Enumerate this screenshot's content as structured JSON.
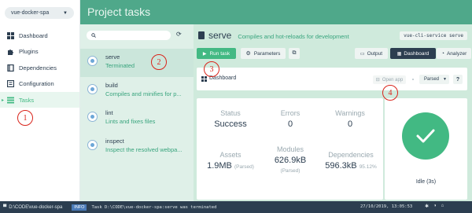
{
  "project": {
    "name": "vue-docker-spa"
  },
  "sidebar": {
    "items": [
      {
        "label": "Dashboard",
        "icon": "dashboard-icon"
      },
      {
        "label": "Plugins",
        "icon": "puzzle-icon"
      },
      {
        "label": "Dependencies",
        "icon": "book-icon"
      },
      {
        "label": "Configuration",
        "icon": "settings-icon"
      },
      {
        "label": "Tasks",
        "icon": "list-icon",
        "active": true
      }
    ]
  },
  "header": {
    "title": "Project tasks"
  },
  "tasks": [
    {
      "name": "serve",
      "description": "Terminated",
      "active": true
    },
    {
      "name": "build",
      "description": "Compiles and minifies for p..."
    },
    {
      "name": "lint",
      "description": "Lints and fixes files"
    },
    {
      "name": "inspect",
      "description": "Inspect the resolved webpa..."
    }
  ],
  "task_detail": {
    "name": "serve",
    "description": "Compiles and hot-reloads for development",
    "command": "vue-cli-service serve"
  },
  "toolbar": {
    "run": "Run task",
    "parameters": "Parameters",
    "output": "Output",
    "dashboard": "Dashboard",
    "analyzer": "Analyzer"
  },
  "dashboard": {
    "title": "Dashboard",
    "open_app": "Open app",
    "mode": "Parsed",
    "help": "?"
  },
  "stats": {
    "status": {
      "label": "Status",
      "value": "Success"
    },
    "errors": {
      "label": "Errors",
      "value": "0"
    },
    "warnings": {
      "label": "Warnings",
      "value": "0"
    },
    "assets": {
      "label": "Assets",
      "value": "1.9MB",
      "sub": "(Parsed)"
    },
    "modules": {
      "label": "Modules",
      "value": "626.9kB",
      "sub": "(Parsed)"
    },
    "dependencies": {
      "label": "Dependencies",
      "value": "596.3kB",
      "sub": "95.12%"
    }
  },
  "idle": {
    "label": "Idle (3s)"
  },
  "statusbar": {
    "path": "D:\\CODE\\vue-docker-spa",
    "badge": "INFO",
    "message": "Task D:\\CODE\\vue-docker-spa:serve was terminated",
    "time": "27/10/2019, 13:05:53"
  },
  "annotations": [
    "1",
    "2",
    "3",
    "4"
  ],
  "colors": {
    "accent": "#42b983",
    "header": "#4fa88a",
    "dark": "#2c3e50",
    "annotation": "#d9241b"
  }
}
